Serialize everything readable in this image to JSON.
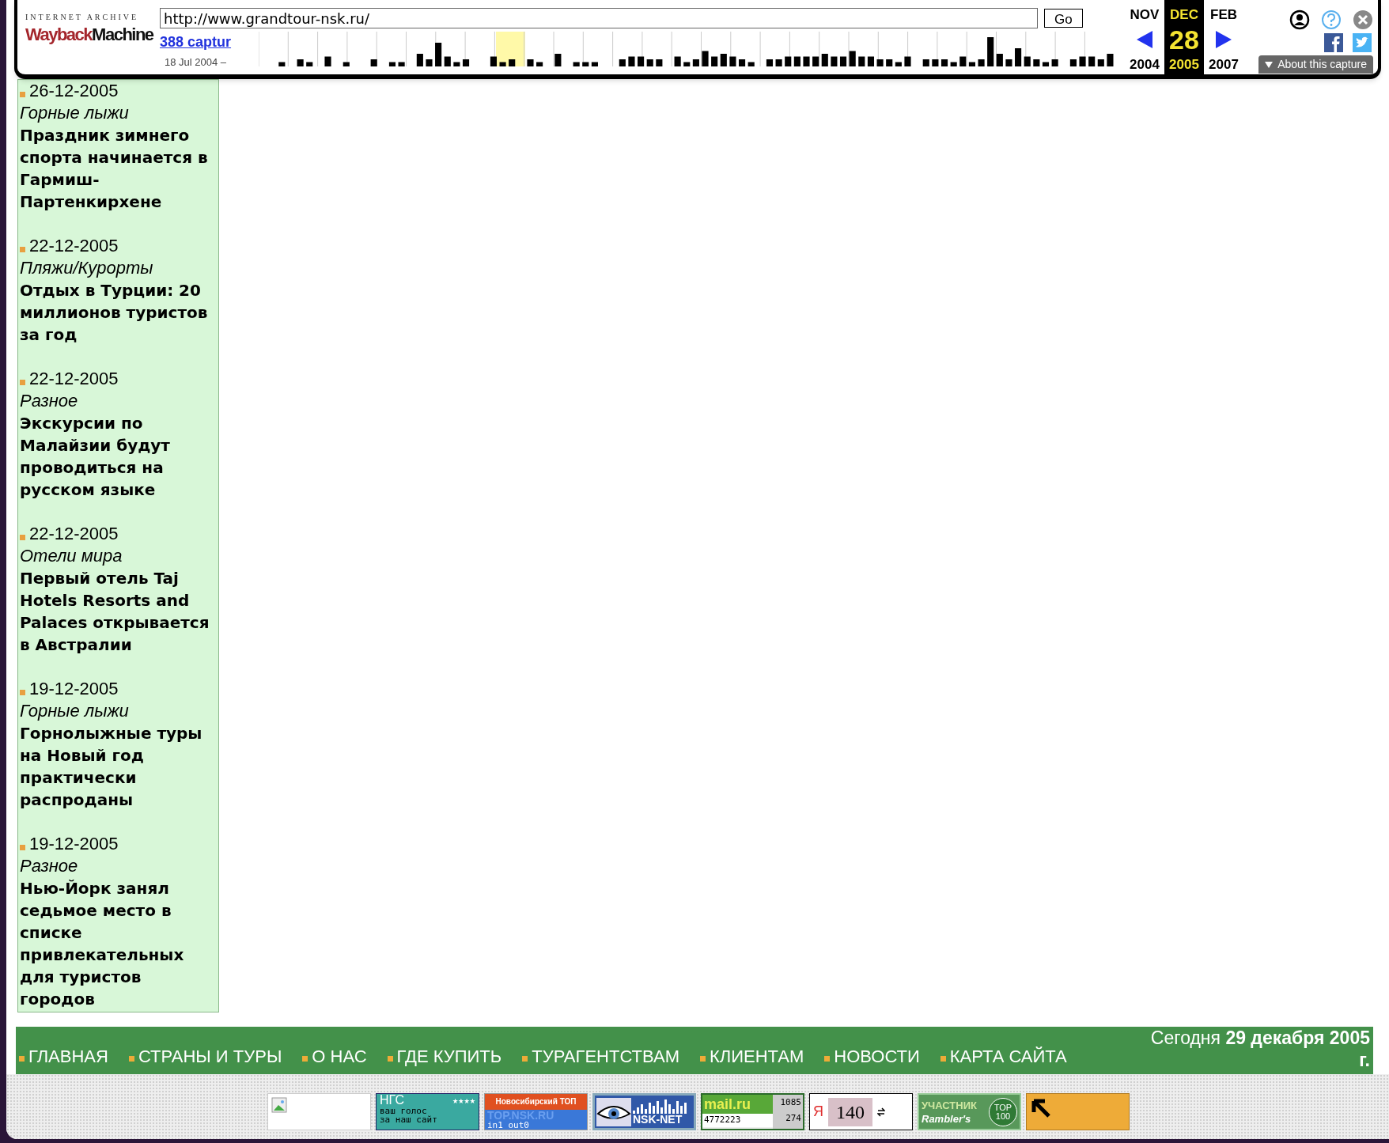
{
  "wayback": {
    "brand_top": "INTERNET ARCHIVE",
    "brand_a": "Wayback",
    "brand_b": "Machine",
    "url": "http://www.grandtour-nsk.ru/",
    "go": "Go",
    "captures": "388 captur",
    "range": "18 Jul 2004 –",
    "months": [
      {
        "month": "NOV",
        "year": "2004",
        "selected": false
      },
      {
        "month": "DEC",
        "day": "28",
        "year": "2005",
        "selected": true
      },
      {
        "month": "FEB",
        "year": "2007",
        "selected": false
      }
    ],
    "about": "About this capture"
  },
  "news": [
    {
      "date": "26-12-2005",
      "category": "Горные лыжи",
      "title": "Праздник зимнего спорта начинается в Гармиш-Партенкирхене"
    },
    {
      "date": "22-12-2005",
      "category": "Пляжи/Курорты",
      "title": "Отдых в Турции: 20 миллионов туристов за год"
    },
    {
      "date": "22-12-2005",
      "category": "Разное",
      "title": "Экскурсии по Малайзии будут проводиться на русском языке"
    },
    {
      "date": "22-12-2005",
      "category": "Отели мира",
      "title": "Первый отель Taj Hotels Resorts and Palaces открывается в Австралии"
    },
    {
      "date": "19-12-2005",
      "category": "Горные лыжи",
      "title": "Горнолыжные туры на Новый год практически распроданы"
    },
    {
      "date": "19-12-2005",
      "category": "Разное",
      "title": "Нью-Йорк занял седьмое место в списке привлекательных для туристов городов"
    }
  ],
  "nav": {
    "items": [
      "ГЛАВНАЯ",
      "СТРАНЫ И ТУРЫ",
      "О НАС",
      "ГДЕ КУПИТЬ",
      "ТУРАГЕНТСТВАМ",
      "КЛИЕНТАМ",
      "НОВОСТИ",
      "КАРТА САЙТА"
    ],
    "today": "Сегодня **29 декабря 2005 г.**"
  },
  "badges": [
    {
      "kind": "broken"
    },
    {
      "kind": "ngs",
      "texts": [
        "НГС",
        "★★★★",
        "ваш голос",
        "за наш сайт"
      ]
    },
    {
      "kind": "nsktop",
      "texts": [
        "Новосибирский ТОП",
        "TOP.NSK.RU",
        "in1 out0"
      ]
    },
    {
      "kind": "nsknet",
      "texts": [
        "NSK-NET"
      ]
    },
    {
      "kind": "mailru",
      "texts": [
        "mail.ru",
        "1085",
        "4772223",
        "274"
      ]
    },
    {
      "kind": "yandex",
      "texts": [
        "Я",
        "140"
      ]
    },
    {
      "kind": "rambler",
      "texts": [
        "УЧАСТНИК",
        "Rambler's",
        "TOP",
        "100"
      ]
    },
    {
      "kind": "arrow"
    }
  ]
}
